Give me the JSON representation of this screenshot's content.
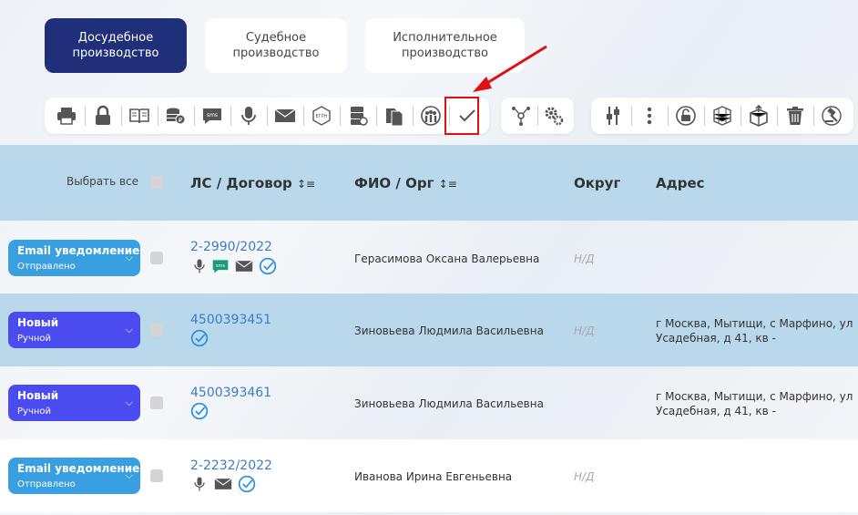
{
  "tabs": [
    {
      "label": "Досудебное\nпроизводство",
      "active": true
    },
    {
      "label": "Судебное\nпроизводство",
      "active": false
    },
    {
      "label": "Исполнительное\nпроизводство",
      "active": false
    }
  ],
  "toolbar_groups": [
    [
      "printer-icon",
      "lock-icon",
      "book-icon",
      "coins-icon",
      "sms-icon",
      "microphone-icon",
      "envelope-icon",
      "egrn-icon",
      "server-icon",
      "documents-icon",
      "people-icon",
      "checkmark-icon"
    ],
    [
      "tree-icon",
      "gears-icon"
    ],
    [
      "sliders-icon",
      "kebab-icon",
      "unlock-icon",
      "cube-grid-icon",
      "box-upload-icon",
      "trash-icon",
      "gavel-icon"
    ]
  ],
  "egrn_text": "ЕГРН",
  "sms_text": "sms",
  "table": {
    "select_all_label": "Выбрать все",
    "columns": {
      "ls": "ЛС / Договор",
      "fio": "ФИО / Орг",
      "okrug": "Округ",
      "address": "Адрес"
    },
    "rows": [
      {
        "status": "Email уведомление",
        "sub": "Отправлено",
        "status_type": "email",
        "ls": "2-2990/2022",
        "icons": [
          "microphone-icon",
          "sms-icon",
          "envelope-icon",
          "verified-icon"
        ],
        "fio": "Герасимова Оксана Валерьевна",
        "okrug": "Н/Д",
        "address": ""
      },
      {
        "status": "Новый",
        "sub": "Ручной",
        "status_type": "new",
        "ls": "4500393451",
        "icons": [
          "verified-icon"
        ],
        "fio": "Зиновьева Людмила Васильевна",
        "okrug": "Н/Д",
        "address": "г Москва, Мытищи, с Марфино, ул\nУсадебная, д 41, кв -"
      },
      {
        "status": "Новый",
        "sub": "Ручной",
        "status_type": "new",
        "ls": "4500393461",
        "icons": [
          "verified-icon"
        ],
        "fio": "Зиновьева Людмила Васильевна",
        "okrug": "",
        "address": "г Москва, Мытищи, с Марфино, ул\nУсадебная, д 41, кв -"
      },
      {
        "status": "Email уведомление",
        "sub": "Отправлено",
        "status_type": "email",
        "ls": "2-2232/2022",
        "icons": [
          "microphone-icon",
          "envelope-icon",
          "verified-icon"
        ],
        "fio": "Иванова Ирина Евгеньевна",
        "okrug": "Н/Д",
        "address": ""
      }
    ]
  },
  "colors": {
    "accent": "#1f2f7a",
    "link": "#3a7dc6",
    "highlight": "#e01010",
    "email_status": "#3a9fe0",
    "new_status": "#4a4cf0"
  }
}
